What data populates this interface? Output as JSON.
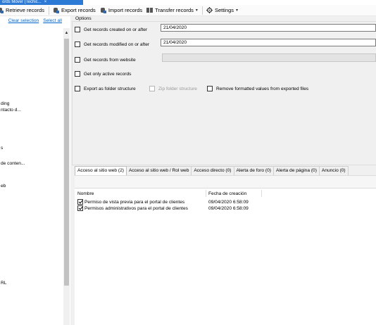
{
  "window_tab": {
    "title": "ords Mover (Techic...",
    "close": "×"
  },
  "toolbar": {
    "retrieve": "Retrieve records",
    "export": "Export records",
    "import": "Import records",
    "transfer": "Transfer records",
    "transfer_caret": "▾",
    "settings": "Settings",
    "settings_caret": "▾"
  },
  "left": {
    "clear_selection": "Clear selection",
    "select_all": "Select all",
    "items": [
      "ding",
      "ntacto d...",
      "s",
      "de conten...",
      "eb",
      "RL"
    ]
  },
  "options": {
    "title": "Options",
    "created_label": "Get records created on or after",
    "created_value": "21/04/2020",
    "modified_label": "Get records modified on or after",
    "modified_value": "21/04/2020",
    "website_label": "Get records from website",
    "active_label": "Get only active records",
    "export_folder_label": "Export as folder structure",
    "zip_label": "Zip folder structure",
    "remove_formatted_label": "Remove formatted values from exported files"
  },
  "tabs": [
    "Acceso al sitio web (2)",
    "Acceso al sitio web / Rol web",
    "Acceso directo (0)",
    "Alerta de foro (0)",
    "Alerta de página (0)",
    "Anuncio (0)"
  ],
  "grid": {
    "col_name": "Nombre",
    "col_date": "Fecha de creación",
    "rows": [
      {
        "name": "Permiso de vista previa para el portal de clientes",
        "date": "09/04/2020 6:58:09",
        "checked": true
      },
      {
        "name": "Permisos administrativos para el portal de clientes",
        "date": "09/04/2020 6:58:09",
        "checked": true
      }
    ]
  },
  "colors": {
    "accent": "#2d7ad6",
    "link": "#0066cc",
    "panel": "#f0f0f0"
  }
}
